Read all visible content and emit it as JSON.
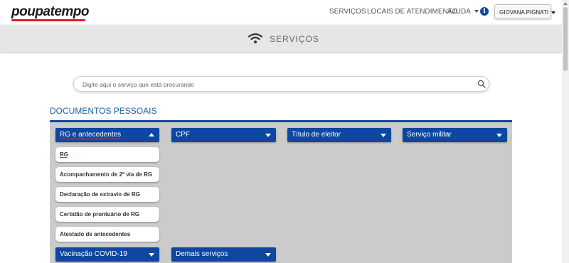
{
  "header": {
    "logo_text": "poupatempo",
    "nav": [
      {
        "label": "SERVIÇOS"
      },
      {
        "label": "LOCAIS DE ATENDIMENTO"
      },
      {
        "label": "AJUDA"
      }
    ],
    "info_icon": "info-icon",
    "user_name": "GIOVANA PIGNATI"
  },
  "banner": {
    "icon": "wifi-icon",
    "title": "SERVIÇOS"
  },
  "search": {
    "placeholder": "Digite aqui o serviço que está procurando",
    "icon": "search-icon"
  },
  "section": {
    "title": "DOCUMENTOS PESSOAIS",
    "categories": [
      {
        "label": "RG e antecedentes",
        "expanded": true
      },
      {
        "label": "CPF",
        "expanded": false
      },
      {
        "label": "Título de eleitor",
        "expanded": false
      },
      {
        "label": "Serviço militar",
        "expanded": false
      },
      {
        "label": "Vacinação COVID-19",
        "expanded": false
      },
      {
        "label": "Demais serviços",
        "expanded": false
      }
    ],
    "subitems": [
      {
        "label": "RG"
      },
      {
        "label": "Acompanhamento de 2ª via de RG"
      },
      {
        "label": "Declaração de extravio de RG"
      },
      {
        "label": "Certidão de prontuário de RG"
      },
      {
        "label": "Atestado de antecedentes"
      }
    ]
  },
  "colors": {
    "accent_blue": "#0d47a1",
    "logo_red": "#d9202b",
    "panel_gray": "#cbcbcb"
  }
}
